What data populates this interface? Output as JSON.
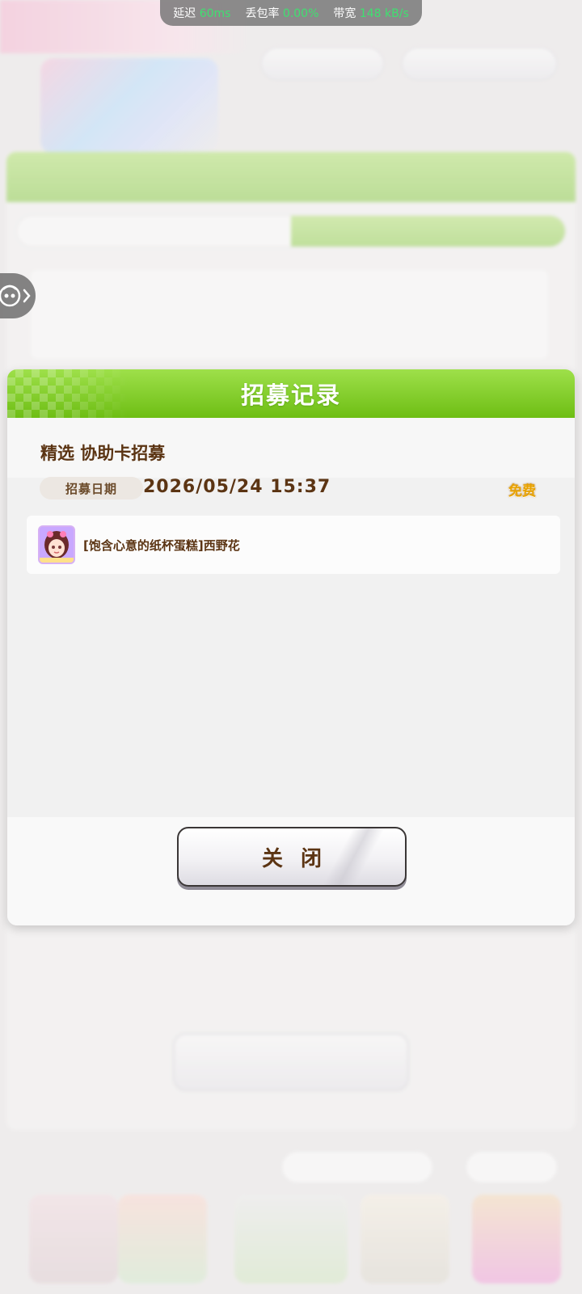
{
  "status_bar": {
    "latency_label": "延迟",
    "latency_value": "60ms",
    "loss_label": "丢包率",
    "loss_value": "0.00%",
    "bandwidth_label": "带宽",
    "bandwidth_value": "148 kB/s"
  },
  "modal": {
    "title": "招募记录",
    "record_title": "精选 协助卡招募",
    "date_label": "招募日期",
    "date_value": "2026/05/24 15:37",
    "cost_tag": "免费",
    "items": [
      {
        "name": "[饱含心意的纸杯蛋糕]西野花"
      }
    ],
    "close_label": "关闭"
  },
  "colors": {
    "header_green": "#7cc522",
    "text_brown": "#5b3413",
    "free_gold": "#e8a200",
    "status_green": "#3fe070"
  }
}
